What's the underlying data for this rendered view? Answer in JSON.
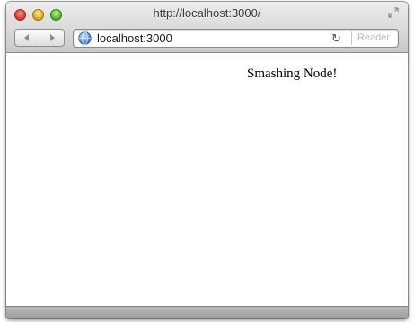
{
  "window": {
    "title": "http://localhost:3000/",
    "controls": {
      "close_icon": "close-icon",
      "minimize_icon": "minimize-icon",
      "zoom_icon": "zoom-icon",
      "fullscreen_icon": "fullscreen-icon"
    }
  },
  "toolbar": {
    "back_icon": "back-arrow-icon",
    "forward_icon": "forward-arrow-icon",
    "address": {
      "url": "localhost:3000",
      "site_icon": "globe-icon",
      "reload_icon": "reload-icon",
      "reader_label": "Reader"
    }
  },
  "page": {
    "text": "Smashing Node!"
  },
  "colors": {
    "close": "#e0443a",
    "minimize": "#e8b12a",
    "zoom": "#5fbf3a",
    "reader_disabled": "#b9b9b9"
  }
}
